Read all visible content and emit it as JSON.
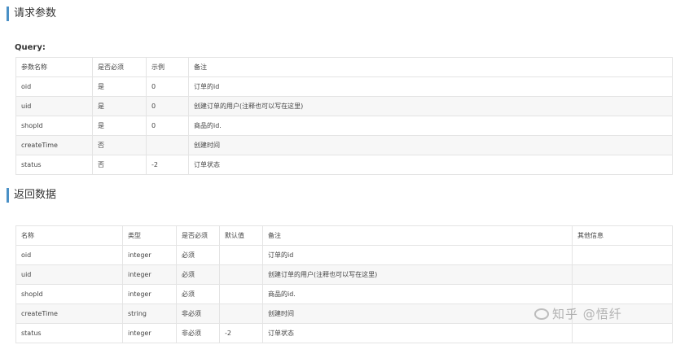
{
  "request": {
    "title": "请求参数",
    "query_label": "Query:",
    "headers": [
      "参数名称",
      "是否必须",
      "示例",
      "备注"
    ],
    "rows": [
      [
        "oid",
        "是",
        "0",
        "订单的id"
      ],
      [
        "uid",
        "是",
        "0",
        "创建订单的用户(注释也可以写在这里)"
      ],
      [
        "shopId",
        "是",
        "0",
        "商品的id."
      ],
      [
        "createTime",
        "否",
        "",
        "创建时间"
      ],
      [
        "status",
        "否",
        "-2",
        "订单状态"
      ]
    ]
  },
  "response": {
    "title": "返回数据",
    "headers": [
      "名称",
      "类型",
      "是否必须",
      "默认值",
      "备注",
      "其他信息"
    ],
    "rows": [
      [
        "oid",
        "integer",
        "必须",
        "",
        "订单的id",
        ""
      ],
      [
        "uid",
        "integer",
        "必须",
        "",
        "创建订单的用户(注释也可以写在这里)",
        ""
      ],
      [
        "shopId",
        "integer",
        "必须",
        "",
        "商品的id.",
        ""
      ],
      [
        "createTime",
        "string",
        "非必须",
        "",
        "创建时间",
        ""
      ],
      [
        "status",
        "integer",
        "非必须",
        "-2",
        "订单状态",
        ""
      ]
    ]
  },
  "watermark": "知乎 @悟纤"
}
